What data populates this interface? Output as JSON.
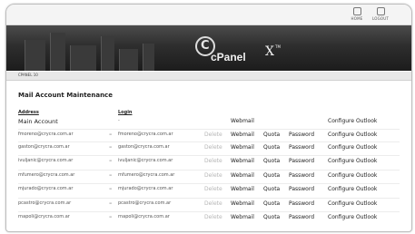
{
  "topnav": {
    "home_label": "HOME",
    "logout_label": "LOGOUT",
    "home_icon": "home-icon",
    "logout_icon": "logout-icon"
  },
  "banner": {
    "logo_mark": "C",
    "logo_text": "cPanel",
    "logo_x": "X",
    "logo_tm": "TM"
  },
  "breadcrumb": "CPANEL 10",
  "page_title": "Mail Account Maintenance",
  "headers": {
    "address": "Address",
    "login": "Login"
  },
  "main_account": {
    "label": "Main Account",
    "login": "-",
    "webmail": "Webmail",
    "configure": "Configure Outlook"
  },
  "accounts": [
    {
      "email": "fmoreno@crycra.com.ar",
      "eq": "=",
      "login": "fmoreno@crycra.com.ar",
      "delete": "Delete",
      "webmail": "Webmail",
      "quota": "Quota",
      "password": "Password",
      "configure": "Configure Outlook"
    },
    {
      "email": "gaston@crycra.com.ar",
      "eq": "=",
      "login": "gaston@crycra.com.ar",
      "delete": "Delete",
      "webmail": "Webmail",
      "quota": "Quota",
      "password": "Password",
      "configure": "Configure Outlook"
    },
    {
      "email": "ivuljanic@crycra.com.ar",
      "eq": "=",
      "login": "ivuljanic@crycra.com.ar",
      "delete": "Delete",
      "webmail": "Webmail",
      "quota": "Quota",
      "password": "Password",
      "configure": "Configure Outlook"
    },
    {
      "email": "mfumero@crycra.com.ar",
      "eq": "=",
      "login": "mfumero@crycra.com.ar",
      "delete": "Delete",
      "webmail": "Webmail",
      "quota": "Quota",
      "password": "Password",
      "configure": "Configure Outlook"
    },
    {
      "email": "mjurado@crycra.com.ar",
      "eq": "=",
      "login": "mjurado@crycra.com.ar",
      "delete": "Delete",
      "webmail": "Webmail",
      "quota": "Quota",
      "password": "Password",
      "configure": "Configure Outlook"
    },
    {
      "email": "pcastro@crycra.com.ar",
      "eq": "=",
      "login": "pcastro@crycra.com.ar",
      "delete": "Delete",
      "webmail": "Webmail",
      "quota": "Quota",
      "password": "Password",
      "configure": "Configure Outlook"
    },
    {
      "email": "rnapoli@crycra.com.ar",
      "eq": "=",
      "login": "rnapoli@crycra.com.ar",
      "delete": "Delete",
      "webmail": "Webmail",
      "quota": "Quota",
      "password": "Password",
      "configure": "Configure Outlook"
    }
  ]
}
